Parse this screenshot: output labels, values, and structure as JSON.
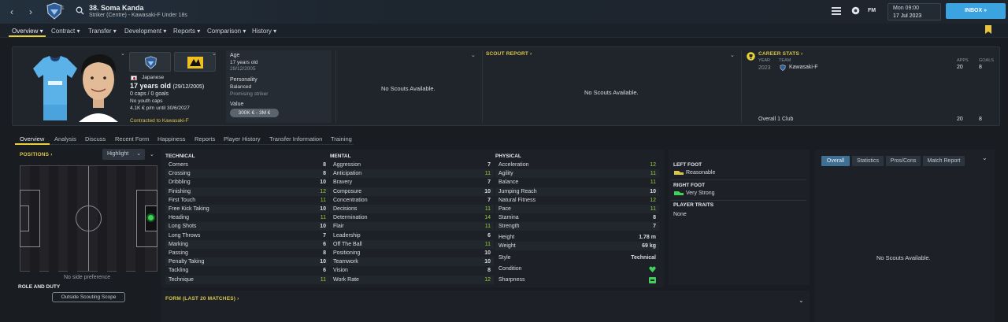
{
  "header": {
    "player_number_name": "38. Soma Kanda",
    "player_subtitle": "Striker (Centre) - Kawasaki-F Under 18s",
    "date_line1": "Mon 09:00",
    "date_line2": "17 Jul 2023",
    "inbox_label": "INBOX",
    "fm_label": "FM"
  },
  "menu": [
    "Overview",
    "Contract",
    "Transfer",
    "Development",
    "Reports",
    "Comparison",
    "History"
  ],
  "profile": {
    "nationality": "Japanese",
    "age_line": "17 years old",
    "dob": "(29/12/2005)",
    "caps": "0 caps / 0 goals",
    "youth_caps": "No youth caps",
    "wage": "4.1K € p/m until 30/6/2027",
    "contracted": "Contracted to Kawasaki-F",
    "age_label": "Age",
    "age_value": "17 years old",
    "age_date": "29/12/2005",
    "personality_label": "Personality",
    "personality_value": "Balanced",
    "personality_sub": "Promising striker",
    "value_label": "Value",
    "value_range": "300K € - 3M €",
    "no_scouts_1": "No Scouts Available.",
    "scout_report": "SCOUT REPORT",
    "no_scouts_2": "No Scouts Available.",
    "career_stats": "CAREER STATS",
    "col_year": "YEAR",
    "col_team": "TEAM",
    "col_apps": "APPS",
    "col_goals": "GOALS",
    "career_row": {
      "year": "2023",
      "team": "Kawasaki-F",
      "apps": "20",
      "goals": "8"
    },
    "overall_label": "Overall 1 Club",
    "overall_apps": "20",
    "overall_goals": "8"
  },
  "subtabs": [
    "Overview",
    "Analysis",
    "Discuss",
    "Recent Form",
    "Happiness",
    "Reports",
    "Player History",
    "Transfer Information",
    "Training"
  ],
  "positions": {
    "title": "POSITIONS",
    "highlight": "Highlight",
    "side_pref": "No side preference",
    "role_title": "ROLE AND DUTY",
    "scope_btn": "Outside Scouting Scope"
  },
  "technical": {
    "title": "TECHNICAL",
    "rows": [
      [
        "Corners",
        "8"
      ],
      [
        "Crossing",
        "8"
      ],
      [
        "Dribbling",
        "10"
      ],
      [
        "Finishing",
        "12"
      ],
      [
        "First Touch",
        "11"
      ],
      [
        "Free Kick Taking",
        "10"
      ],
      [
        "Heading",
        "11"
      ],
      [
        "Long Shots",
        "10"
      ],
      [
        "Long Throws",
        "7"
      ],
      [
        "Marking",
        "6"
      ],
      [
        "Passing",
        "8"
      ],
      [
        "Penalty Taking",
        "10"
      ],
      [
        "Tackling",
        "6"
      ],
      [
        "Technique",
        "11"
      ]
    ]
  },
  "mental": {
    "title": "MENTAL",
    "rows": [
      [
        "Aggression",
        "7"
      ],
      [
        "Anticipation",
        "11"
      ],
      [
        "Bravery",
        "7"
      ],
      [
        "Composure",
        "10"
      ],
      [
        "Concentration",
        "7"
      ],
      [
        "Decisions",
        "11"
      ],
      [
        "Determination",
        "14"
      ],
      [
        "Flair",
        "11"
      ],
      [
        "Leadership",
        "6"
      ],
      [
        "Off The Ball",
        "11"
      ],
      [
        "Positioning",
        "10"
      ],
      [
        "Teamwork",
        "10"
      ],
      [
        "Vision",
        "8"
      ],
      [
        "Work Rate",
        "12"
      ]
    ]
  },
  "physical": {
    "title": "PHYSICAL",
    "rows": [
      [
        "Acceleration",
        "12"
      ],
      [
        "Agility",
        "11"
      ],
      [
        "Balance",
        "11"
      ],
      [
        "Jumping Reach",
        "10"
      ],
      [
        "Natural Fitness",
        "12"
      ],
      [
        "Pace",
        "11"
      ],
      [
        "Stamina",
        "8"
      ],
      [
        "Strength",
        "7"
      ]
    ],
    "height_label": "Height",
    "height": "1.78 m",
    "weight_label": "Weight",
    "weight": "69 kg",
    "style_label": "Style",
    "style": "Technical",
    "condition_label": "Condition",
    "sharpness_label": "Sharpness"
  },
  "feet": {
    "left_title": "LEFT FOOT",
    "left_value": "Reasonable",
    "right_title": "RIGHT FOOT",
    "right_value": "Very Strong",
    "traits_title": "PLAYER TRAITS",
    "traits_value": "None"
  },
  "right_panel": {
    "tabs": [
      "Overall",
      "Statistics",
      "Pros/Cons",
      "Match Report"
    ],
    "no_scouts": "No Scouts Available."
  },
  "form_title": "FORM (LAST 20 MATCHES)",
  "colors": {
    "accent": "#e8d23a",
    "inbox": "#3aa3e0",
    "good": "#9bd33a",
    "condition": "#3fd15a"
  }
}
